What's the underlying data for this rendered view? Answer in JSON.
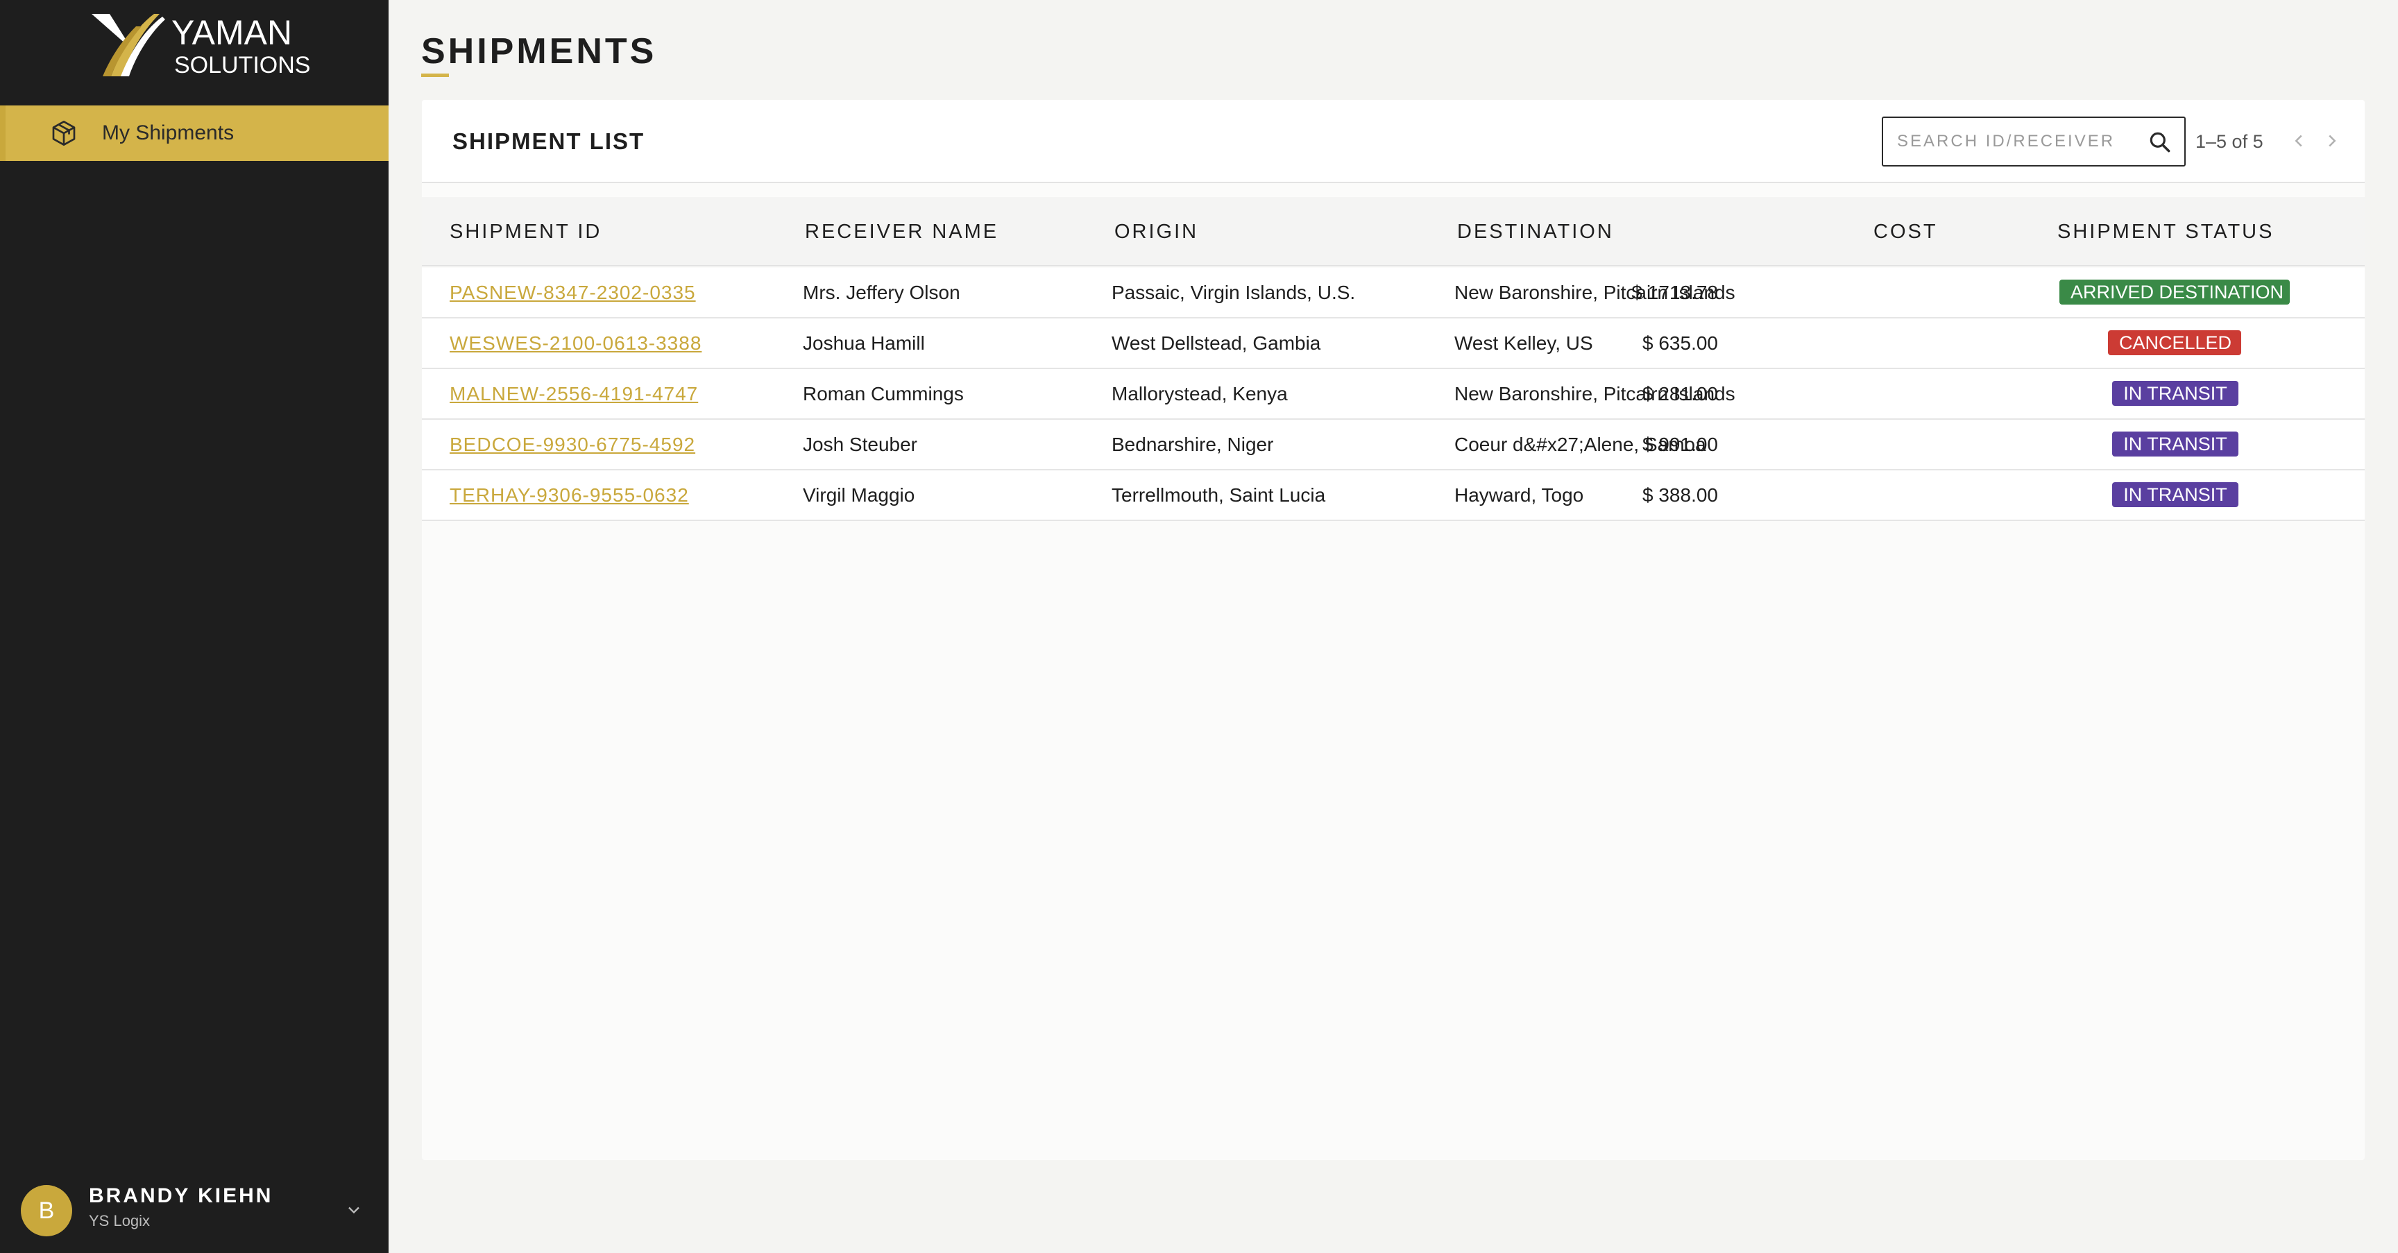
{
  "brand": {
    "line1": "YAMAN",
    "line2": "SOLUTIONS",
    "accent": "#d4b44a"
  },
  "sidebar": {
    "items": [
      {
        "label": "My Shipments",
        "icon": "package-icon",
        "active": true
      }
    ]
  },
  "user": {
    "initial": "B",
    "name": "BRANDY KIEHN",
    "org": "YS Logix"
  },
  "page": {
    "title": "SHIPMENTS"
  },
  "list": {
    "title": "SHIPMENT LIST",
    "search_placeholder": "SEARCH ID/RECEIVER",
    "pagination": "1–5 of 5",
    "columns": [
      "SHIPMENT ID",
      "RECEIVER NAME",
      "ORIGIN",
      "DESTINATION",
      "COST",
      "SHIPMENT STATUS"
    ],
    "rows": [
      {
        "id": "PASNEW-8347-2302-0335",
        "receiver": "Mrs. Jeffery Olson",
        "origin": "Passaic, Virgin Islands, U.S.",
        "destination": "New Baronshire, Pitcairn Islands",
        "cost": "$ 1713.78",
        "status": "ARRIVED DESTINATION",
        "status_color": "#3a8a47"
      },
      {
        "id": "WESWES-2100-0613-3388",
        "receiver": "Joshua Hamill",
        "origin": "West Dellstead, Gambia",
        "destination": "West Kelley, US",
        "cost": "$ 635.00",
        "status": "CANCELLED",
        "status_color": "#cc3b34"
      },
      {
        "id": "MALNEW-2556-4191-4747",
        "receiver": "Roman Cummings",
        "origin": "Mallorystead, Kenya",
        "destination": "New Baronshire, Pitcairn Islands",
        "cost": "$ 281.00",
        "status": "IN TRANSIT",
        "status_color": "#5a3fa0"
      },
      {
        "id": "BEDCOE-9930-6775-4592",
        "receiver": "Josh Steuber",
        "origin": "Bednarshire, Niger",
        "destination": "Coeur d&#x27;Alene, Samoa",
        "cost": "$ 991.00",
        "status": "IN TRANSIT",
        "status_color": "#5a3fa0"
      },
      {
        "id": "TERHAY-9306-9555-0632",
        "receiver": "Virgil Maggio",
        "origin": "Terrellmouth, Saint Lucia",
        "destination": "Hayward, Togo",
        "cost": "$ 388.00",
        "status": "IN TRANSIT",
        "status_color": "#5a3fa0"
      }
    ]
  }
}
